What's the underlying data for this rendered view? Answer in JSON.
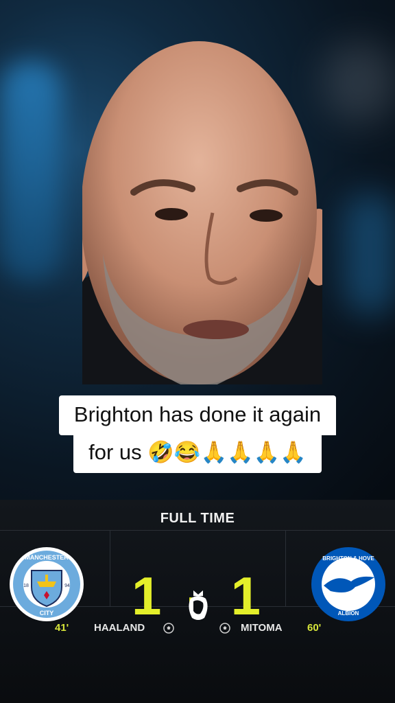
{
  "caption": {
    "line1": "Brighton has done it again",
    "line2": "for us 🤣😂🙏🙏🙏🙏"
  },
  "scoreboard": {
    "status": "FULL TIME",
    "home_score": "1",
    "separator": "-",
    "away_score": "1",
    "home_badge": {
      "top_text": "MANCHESTER",
      "bottom_text": "CITY",
      "year_left": "18",
      "year_right": "94"
    },
    "away_badge": {
      "top_text": "BRIGHTON & HOVE",
      "bottom_text": "ALBION"
    },
    "events": {
      "home_minute": "41'",
      "home_scorer": "HAALAND",
      "away_scorer": "MITOMA",
      "away_minute": "60'"
    }
  },
  "colors": {
    "score": "#e4ef2a",
    "panel": "#0d1014",
    "city_blue": "#6cabdd",
    "brighton_blue": "#0057b8"
  }
}
